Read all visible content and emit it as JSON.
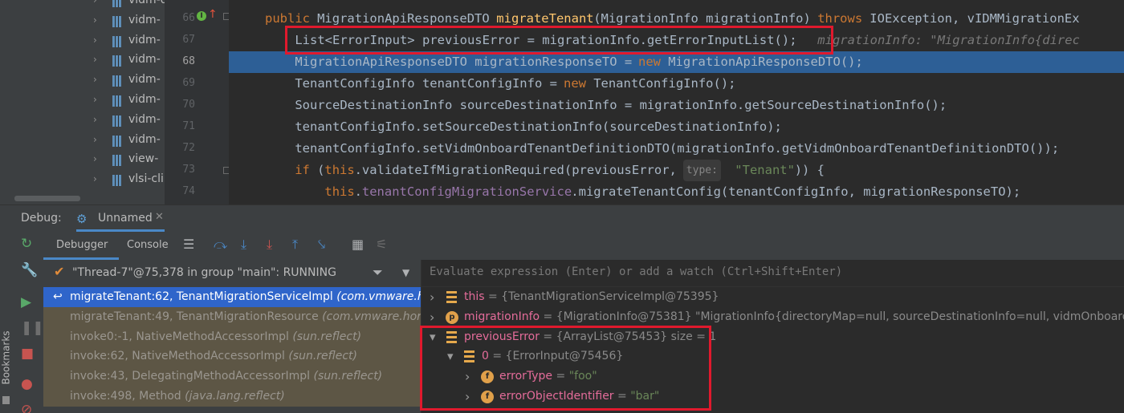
{
  "project_tree": {
    "items": [
      "vidm-d",
      "vidm-",
      "vidm-",
      "vidm-",
      "vidm-",
      "vidm-",
      "vidm-",
      "vidm-",
      "view-",
      "vlsi-cli"
    ]
  },
  "editor": {
    "lines": [
      {
        "num": "66",
        "segments": [
          {
            "text": "public ",
            "cls": "kw"
          },
          {
            "text": "MigrationApiResponseDTO ",
            "cls": ""
          },
          {
            "text": "migrateTenant",
            "cls": "fn"
          },
          {
            "text": "(MigrationInfo migrationInfo) ",
            "cls": ""
          },
          {
            "text": "throws ",
            "cls": "kw"
          },
          {
            "text": "IOException, vIDMMigrationEx",
            "cls": ""
          }
        ]
      },
      {
        "num": "67",
        "segments": [
          {
            "text": "    List<ErrorInput> previousError = migrationInfo.getErrorInputList();",
            "cls": ""
          },
          {
            "text": "   migrationInfo: \"MigrationInfo{direc",
            "cls": "inlay"
          }
        ]
      },
      {
        "num": "68",
        "segments": [
          {
            "text": "    MigrationApiResponseDTO migrationResponseTO = ",
            "cls": ""
          },
          {
            "text": "new ",
            "cls": "kw"
          },
          {
            "text": "MigrationApiResponseDTO();",
            "cls": ""
          }
        ]
      },
      {
        "num": "69",
        "segments": [
          {
            "text": "    TenantConfigInfo tenantConfigInfo = ",
            "cls": ""
          },
          {
            "text": "new ",
            "cls": "kw"
          },
          {
            "text": "TenantConfigInfo();",
            "cls": ""
          }
        ]
      },
      {
        "num": "70",
        "segments": [
          {
            "text": "    SourceDestinationInfo sourceDestinationInfo = migrationInfo.getSourceDestinationInfo();",
            "cls": ""
          }
        ]
      },
      {
        "num": "71",
        "segments": [
          {
            "text": "    tenantConfigInfo.setSourceDestinationInfo(sourceDestinationInfo);",
            "cls": ""
          }
        ]
      },
      {
        "num": "72",
        "segments": [
          {
            "text": "    tenantConfigInfo.setVidmOnboardTenantDefinitionDTO(migrationInfo.getVidmOnboardTenantDefinitionDTO());",
            "cls": ""
          }
        ]
      },
      {
        "num": "73",
        "segments": [
          {
            "text": "    ",
            "cls": ""
          },
          {
            "text": "if ",
            "cls": "kw"
          },
          {
            "text": "(",
            "cls": ""
          },
          {
            "text": "this",
            "cls": "kw"
          },
          {
            "text": ".validateIfMigrationRequired(previousError, ",
            "cls": ""
          },
          {
            "text": "type:",
            "cls": "hint"
          },
          {
            "text": "\"Tenant\"",
            "cls": "str"
          },
          {
            "text": ")) {",
            "cls": ""
          }
        ]
      },
      {
        "num": "74",
        "segments": [
          {
            "text": "        ",
            "cls": ""
          },
          {
            "text": "this",
            "cls": "kw"
          },
          {
            "text": ".",
            "cls": ""
          },
          {
            "text": "tenantConfigMigrationService",
            "cls": "fld"
          },
          {
            "text": ".migrateTenantConfig(tenantConfigInfo, migrationResponseTO);",
            "cls": ""
          }
        ]
      }
    ]
  },
  "debug_window": {
    "label": "Debug:",
    "tab_label": "Unnamed",
    "subtabs": {
      "debugger": "Debugger",
      "console": "Console"
    },
    "thread": "\"Thread-7\"@75,378 in group \"main\": RUNNING",
    "frames": [
      {
        "text": "migrateTenant:62, TenantMigrationServiceImpl ",
        "pkg": "(com.vmware.horizo",
        "style": "sel"
      },
      {
        "text": "migrateTenant:49, TenantMigrationResource ",
        "pkg": "(com.vmware.horizon.n",
        "style": "dim"
      },
      {
        "text": "invoke0:-1, NativeMethodAccessorImpl ",
        "pkg": "(sun.reflect)",
        "style": "dim"
      },
      {
        "text": "invoke:62, NativeMethodAccessorImpl ",
        "pkg": "(sun.reflect)",
        "style": "dim"
      },
      {
        "text": "invoke:43, DelegatingMethodAccessorImpl ",
        "pkg": "(sun.reflect)",
        "style": "dim"
      },
      {
        "text": "invoke:498, Method ",
        "pkg": "(java.lang.reflect)",
        "style": "dim"
      }
    ],
    "eval_placeholder": "Evaluate expression (Enter) or add a watch (Ctrl+Shift+Enter)",
    "variables": [
      {
        "name": "this",
        "value": " = {TenantMigrationServiceImpl@75395}",
        "icon": "list",
        "expander": "›",
        "indent": 0
      },
      {
        "name": "migrationInfo",
        "value": " = {MigrationInfo@75381} \"MigrationInfo{directoryMap=null, sourceDestinationInfo=null, vidmOnboardTenantD",
        "icon": "p",
        "expander": "›",
        "indent": 0
      },
      {
        "name": "previousError",
        "value": " = {ArrayList@75453}  size = 1",
        "icon": "list",
        "expander": "⌄",
        "indent": 0
      },
      {
        "name": "0",
        "value": " = {ErrorInput@75456}",
        "icon": "list",
        "expander": "⌄",
        "indent": 1
      },
      {
        "name": "errorType",
        "value": " = ",
        "str": "\"foo\"",
        "icon": "f",
        "expander": "›",
        "indent": 2
      },
      {
        "name": "errorObjectIdentifier",
        "value": " = ",
        "str": "\"bar\"",
        "icon": "f",
        "expander": "›",
        "indent": 2
      }
    ],
    "sidebar_label": "Bookmarks"
  }
}
